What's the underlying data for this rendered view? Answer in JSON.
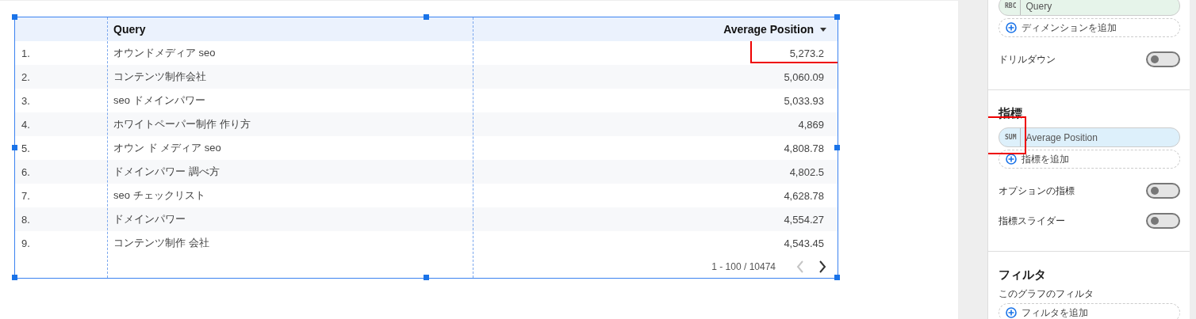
{
  "table": {
    "columns": [
      {},
      {
        "label": "Query"
      },
      {
        "label": "Average Position",
        "sorted": true
      }
    ],
    "rows": [
      {
        "index": "1.",
        "query": "オウンドメディア seo",
        "value": "5,273.2",
        "highlighted": true
      },
      {
        "index": "2.",
        "query": "コンテンツ制作会社",
        "value": "5,060.09",
        "highlighted": false
      },
      {
        "index": "3.",
        "query": "seo ドメインパワー",
        "value": "5,033.93",
        "highlighted": false
      },
      {
        "index": "4.",
        "query": "ホワイトペーパー制作 作り方",
        "value": "4,869",
        "highlighted": false
      },
      {
        "index": "5.",
        "query": "オウン ド メディア seo",
        "value": "4,808.78",
        "highlighted": false
      },
      {
        "index": "6.",
        "query": "ドメインパワー 調べ方",
        "value": "4,802.5",
        "highlighted": false
      },
      {
        "index": "7.",
        "query": "seo チェックリスト",
        "value": "4,628.78",
        "highlighted": false
      },
      {
        "index": "8.",
        "query": "ドメインパワー",
        "value": "4,554.27",
        "highlighted": false
      },
      {
        "index": "9.",
        "query": "コンテンツ制作 会社",
        "value": "4,543.45",
        "highlighted": false
      }
    ],
    "pagination": {
      "range": "1 - 100 / 10474",
      "prev_disabled": true,
      "next_disabled": false
    }
  },
  "panel": {
    "sections": [
      {
        "items": [
          {
            "kind": "chip",
            "type": "RBC",
            "label": "Query",
            "color": "#e6f4ea",
            "highlighted": false
          },
          {
            "kind": "add",
            "label": "ディメンションを追加"
          },
          {
            "kind": "toggle",
            "label": "ドリルダウン",
            "on": false
          }
        ]
      },
      {
        "heading": "指標",
        "items": [
          {
            "kind": "chip",
            "type": "SUM",
            "label": "Average Position",
            "color": "#ddf0fb",
            "highlighted": true
          },
          {
            "kind": "add",
            "label": "指標を追加"
          },
          {
            "kind": "toggle",
            "label": "オプションの指標",
            "on": false
          },
          {
            "kind": "toggle",
            "label": "指標スライダー",
            "on": false
          }
        ]
      },
      {
        "heading": "フィルタ",
        "items": [
          {
            "kind": "caption",
            "label": "このグラフのフィルタ"
          },
          {
            "kind": "add",
            "label": "フィルタを追加"
          }
        ]
      }
    ]
  }
}
